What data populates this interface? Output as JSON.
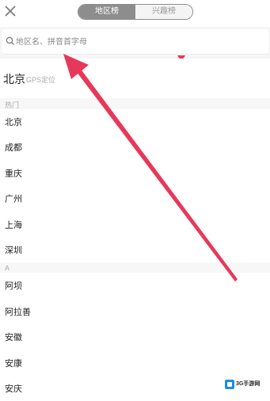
{
  "header": {
    "close_icon": "close-icon",
    "tabs": [
      {
        "label": "地区榜",
        "active": true
      },
      {
        "label": "兴趣榜",
        "active": false
      }
    ]
  },
  "search": {
    "placeholder": "地区名、拼音首字母",
    "icon": "search-icon"
  },
  "gps": {
    "city": "北京",
    "tag": "GPS定位"
  },
  "sections": [
    {
      "title": "热门",
      "cities": [
        "北京",
        "成都",
        "重庆",
        "广州",
        "上海",
        "深圳"
      ]
    },
    {
      "title": "A",
      "cities": [
        "阿坝",
        "阿拉善",
        "安徽",
        "安康",
        "安庆"
      ]
    }
  ],
  "annotation": {
    "color": "#e8385a"
  },
  "watermark": {
    "text": "3G手游网"
  }
}
